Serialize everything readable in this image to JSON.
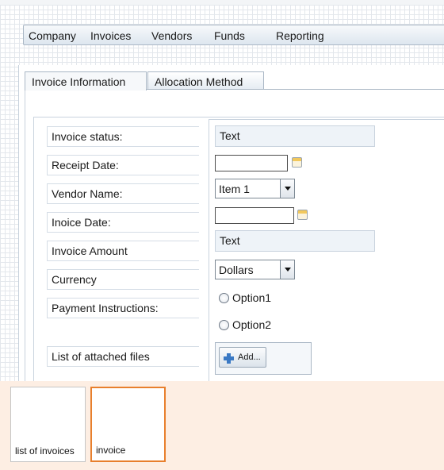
{
  "menubar": {
    "items": [
      "Company",
      "Invoices",
      "Vendors",
      "Funds",
      "Reporting"
    ]
  },
  "tabs": [
    {
      "label": "Invoice Information",
      "active": true
    },
    {
      "label": "Allocation Method",
      "active": false
    }
  ],
  "form": {
    "labels": [
      "Invoice status:",
      "Receipt Date:",
      "Vendor Name:",
      "Inoice Date:",
      "Invoice Amount",
      "Currency",
      "Payment Instructions:",
      "List of attached files"
    ],
    "invoice_status_value": "Text",
    "receipt_date_value": "",
    "vendor_name_selected": "Item 1",
    "invoice_date_value": "",
    "invoice_amount_value": "Text",
    "currency_selected": "Dollars",
    "payment_options": [
      "Option1",
      "Option2"
    ],
    "add_button_label": "Add..."
  },
  "pages": [
    {
      "label": "list of invoices",
      "selected": false
    },
    {
      "label": "invoice",
      "selected": true
    }
  ],
  "colors": {
    "accent_selected": "#e87f2d",
    "strip_background": "#fdeee3",
    "text_field_fill": "#eef3f8"
  },
  "icons": [
    "calendar-icon",
    "chevron-down-icon",
    "plus-icon"
  ]
}
